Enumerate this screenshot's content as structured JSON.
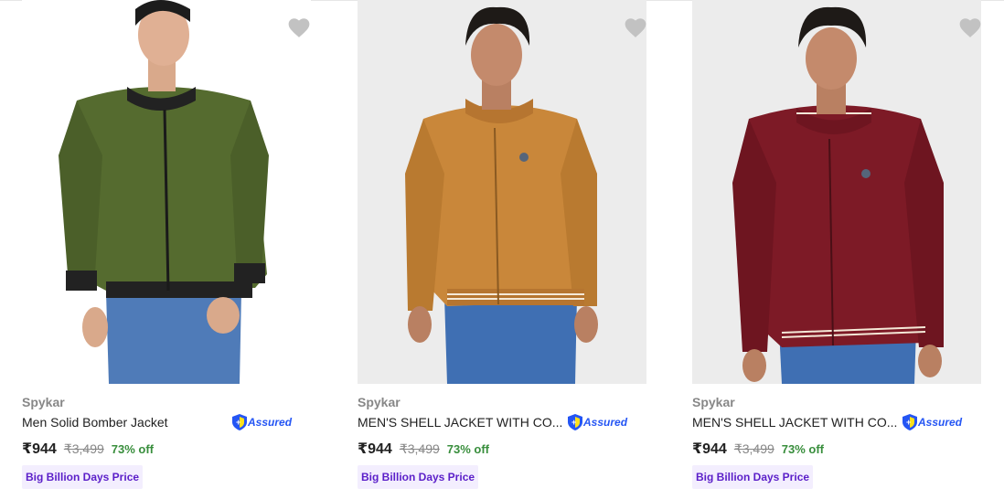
{
  "products": [
    {
      "brand": "Spykar",
      "title": "Men Solid Bomber Jacket",
      "assured_label": "Assured",
      "price": "₹944",
      "mrp": "₹3,499",
      "discount": "73% off",
      "offer": "Big Billion Days Price",
      "jacket_color": "#556b2f",
      "image_bg": "#ffffff"
    },
    {
      "brand": "Spykar",
      "title": "MEN'S SHELL JACKET WITH CO...",
      "assured_label": "Assured",
      "price": "₹944",
      "mrp": "₹3,499",
      "discount": "73% off",
      "offer": "Big Billion Days Price",
      "jacket_color": "#c9873a",
      "image_bg": "#ececec"
    },
    {
      "brand": "Spykar",
      "title": "MEN'S SHELL JACKET WITH CO...",
      "assured_label": "Assured",
      "price": "₹944",
      "mrp": "₹3,499",
      "discount": "73% off",
      "offer": "Big Billion Days Price",
      "jacket_color": "#7d1a26",
      "image_bg": "#ececec"
    }
  ],
  "colors": {
    "brand_text": "#878787",
    "discount_green": "#388e3c",
    "assured_blue": "#2455f4",
    "offer_purple": "#5b1fc9",
    "heart_gray": "#c2c2c2"
  },
  "icons": {
    "wishlist": "heart-icon",
    "assured": "assured-shield-icon"
  }
}
